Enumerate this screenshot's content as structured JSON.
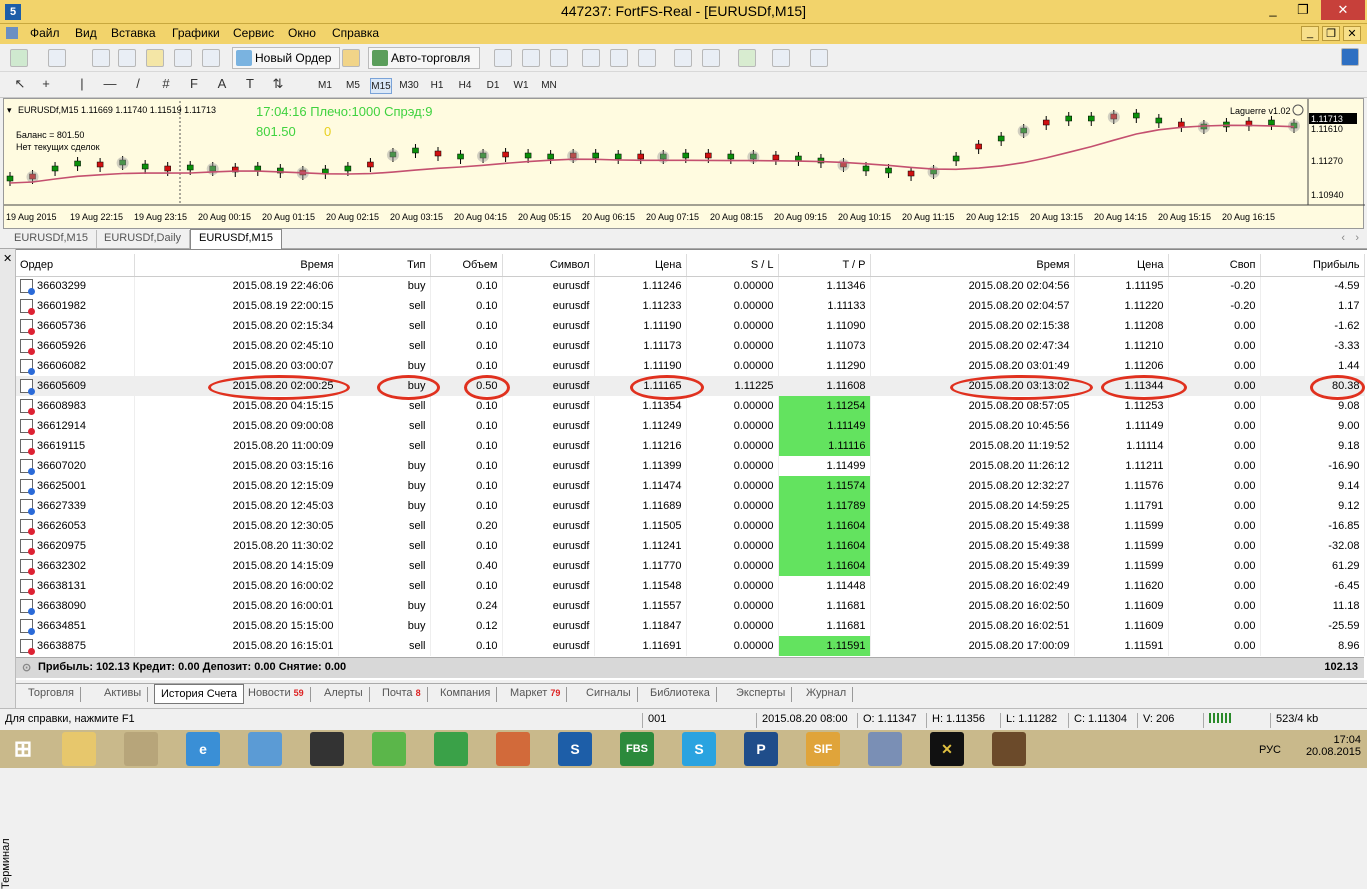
{
  "window": {
    "title": "447237: FortFS-Real - [EURUSDf,M15]",
    "minimize": "_",
    "restore": "❐",
    "close": "✕"
  },
  "menu": [
    "Файл",
    "Вид",
    "Вставка",
    "Графики",
    "Сервис",
    "Окно",
    "Справка"
  ],
  "toolbar": {
    "new_order": "Новый Ордер",
    "auto_trading": "Авто-торговля"
  },
  "timeframes": [
    "M1",
    "M5",
    "M15",
    "M30",
    "H1",
    "H4",
    "D1",
    "W1",
    "MN"
  ],
  "active_timeframe": "M15",
  "chart": {
    "header": "EURUSDf,M15  1.11669 1.11740 1.11519 1.11713",
    "clock_line": "17:04:16 Плечо:1000 Спрэд:9",
    "balance_value": "801.50",
    "zero_value": "0",
    "balance_label": "Баланс = 801.50",
    "no_orders": "Нет текущих сделок",
    "indicator": "Laguerre v1.02",
    "price_labels": [
      "1.11713",
      "1.11610",
      "1.11270",
      "1.10940"
    ],
    "time_labels": [
      "19 Aug 2015",
      "19 Aug 22:15",
      "19 Aug 23:15",
      "20 Aug 00:15",
      "20 Aug 01:15",
      "20 Aug 02:15",
      "20 Aug 03:15",
      "20 Aug 04:15",
      "20 Aug 05:15",
      "20 Aug 06:15",
      "20 Aug 07:15",
      "20 Aug 08:15",
      "20 Aug 09:15",
      "20 Aug 10:15",
      "20 Aug 11:15",
      "20 Aug 12:15",
      "20 Aug 13:15",
      "20 Aug 14:15",
      "20 Aug 15:15",
      "20 Aug 16:15"
    ],
    "line_color": "#c4506f",
    "candle_up": "#0a8f0a",
    "candle_down": "#d01010",
    "bg": "#fffbe0"
  },
  "symbol_tabs": [
    "EURUSDf,M15",
    "EURUSDf,Daily",
    "EURUSDf,M15"
  ],
  "columns": [
    "Ордер",
    "Время",
    "Тип",
    "Объем",
    "Символ",
    "Цена",
    "S / L",
    "T / P",
    "Время",
    "Цена",
    "Своп",
    "Прибыль"
  ],
  "orders": [
    {
      "id": "36603299",
      "open": "2015.08.19 22:46:06",
      "type": "buy",
      "vol": "0.10",
      "sym": "eurusdf",
      "price": "1.11246",
      "sl": "0.00000",
      "tp": "1.11346",
      "close": "2015.08.20 02:04:56",
      "cprice": "1.11195",
      "swap": "-0.20",
      "profit": "-4.59",
      "tphit": false
    },
    {
      "id": "36601982",
      "open": "2015.08.19 22:00:15",
      "type": "sell",
      "vol": "0.10",
      "sym": "eurusdf",
      "price": "1.11233",
      "sl": "0.00000",
      "tp": "1.11133",
      "close": "2015.08.20 02:04:57",
      "cprice": "1.11220",
      "swap": "-0.20",
      "profit": "1.17",
      "tphit": false
    },
    {
      "id": "36605736",
      "open": "2015.08.20 02:15:34",
      "type": "sell",
      "vol": "0.10",
      "sym": "eurusdf",
      "price": "1.11190",
      "sl": "0.00000",
      "tp": "1.11090",
      "close": "2015.08.20 02:15:38",
      "cprice": "1.11208",
      "swap": "0.00",
      "profit": "-1.62",
      "tphit": false
    },
    {
      "id": "36605926",
      "open": "2015.08.20 02:45:10",
      "type": "sell",
      "vol": "0.10",
      "sym": "eurusdf",
      "price": "1.11173",
      "sl": "0.00000",
      "tp": "1.11073",
      "close": "2015.08.20 02:47:34",
      "cprice": "1.11210",
      "swap": "0.00",
      "profit": "-3.33",
      "tphit": false
    },
    {
      "id": "36606082",
      "open": "2015.08.20 03:00:07",
      "type": "buy",
      "vol": "0.10",
      "sym": "eurusdf",
      "price": "1.11190",
      "sl": "0.00000",
      "tp": "1.11290",
      "close": "2015.08.20 03:01:49",
      "cprice": "1.11206",
      "swap": "0.00",
      "profit": "1.44",
      "tphit": false
    },
    {
      "id": "36605609",
      "open": "2015.08.20 02:00:25",
      "type": "buy",
      "vol": "0.50",
      "sym": "eurusdf",
      "price": "1.11165",
      "sl": "1.11225",
      "tp": "1.11608",
      "close": "2015.08.20 03:13:02",
      "cprice": "1.11344",
      "swap": "0.00",
      "profit": "80.38",
      "tphit": false
    },
    {
      "id": "36608983",
      "open": "2015.08.20 04:15:15",
      "type": "sell",
      "vol": "0.10",
      "sym": "eurusdf",
      "price": "1.11354",
      "sl": "0.00000",
      "tp": "1.11254",
      "close": "2015.08.20 08:57:05",
      "cprice": "1.11253",
      "swap": "0.00",
      "profit": "9.08",
      "tphit": true
    },
    {
      "id": "36612914",
      "open": "2015.08.20 09:00:08",
      "type": "sell",
      "vol": "0.10",
      "sym": "eurusdf",
      "price": "1.11249",
      "sl": "0.00000",
      "tp": "1.11149",
      "close": "2015.08.20 10:45:56",
      "cprice": "1.11149",
      "swap": "0.00",
      "profit": "9.00",
      "tphit": true
    },
    {
      "id": "36619115",
      "open": "2015.08.20 11:00:09",
      "type": "sell",
      "vol": "0.10",
      "sym": "eurusdf",
      "price": "1.11216",
      "sl": "0.00000",
      "tp": "1.11116",
      "close": "2015.08.20 11:19:52",
      "cprice": "1.11114",
      "swap": "0.00",
      "profit": "9.18",
      "tphit": true
    },
    {
      "id": "36607020",
      "open": "2015.08.20 03:15:16",
      "type": "buy",
      "vol": "0.10",
      "sym": "eurusdf",
      "price": "1.11399",
      "sl": "0.00000",
      "tp": "1.11499",
      "close": "2015.08.20 11:26:12",
      "cprice": "1.11211",
      "swap": "0.00",
      "profit": "-16.90",
      "tphit": false
    },
    {
      "id": "36625001",
      "open": "2015.08.20 12:15:09",
      "type": "buy",
      "vol": "0.10",
      "sym": "eurusdf",
      "price": "1.11474",
      "sl": "0.00000",
      "tp": "1.11574",
      "close": "2015.08.20 12:32:27",
      "cprice": "1.11576",
      "swap": "0.00",
      "profit": "9.14",
      "tphit": true
    },
    {
      "id": "36627339",
      "open": "2015.08.20 12:45:03",
      "type": "buy",
      "vol": "0.10",
      "sym": "eurusdf",
      "price": "1.11689",
      "sl": "0.00000",
      "tp": "1.11789",
      "close": "2015.08.20 14:59:25",
      "cprice": "1.11791",
      "swap": "0.00",
      "profit": "9.12",
      "tphit": true
    },
    {
      "id": "36626053",
      "open": "2015.08.20 12:30:05",
      "type": "sell",
      "vol": "0.20",
      "sym": "eurusdf",
      "price": "1.11505",
      "sl": "0.00000",
      "tp": "1.11604",
      "close": "2015.08.20 15:49:38",
      "cprice": "1.11599",
      "swap": "0.00",
      "profit": "-16.85",
      "tphit": true
    },
    {
      "id": "36620975",
      "open": "2015.08.20 11:30:02",
      "type": "sell",
      "vol": "0.10",
      "sym": "eurusdf",
      "price": "1.11241",
      "sl": "0.00000",
      "tp": "1.11604",
      "close": "2015.08.20 15:49:38",
      "cprice": "1.11599",
      "swap": "0.00",
      "profit": "-32.08",
      "tphit": true
    },
    {
      "id": "36632302",
      "open": "2015.08.20 14:15:09",
      "type": "sell",
      "vol": "0.40",
      "sym": "eurusdf",
      "price": "1.11770",
      "sl": "0.00000",
      "tp": "1.11604",
      "close": "2015.08.20 15:49:39",
      "cprice": "1.11599",
      "swap": "0.00",
      "profit": "61.29",
      "tphit": true
    },
    {
      "id": "36638131",
      "open": "2015.08.20 16:00:02",
      "type": "sell",
      "vol": "0.10",
      "sym": "eurusdf",
      "price": "1.11548",
      "sl": "0.00000",
      "tp": "1.11448",
      "close": "2015.08.20 16:02:49",
      "cprice": "1.11620",
      "swap": "0.00",
      "profit": "-6.45",
      "tphit": false
    },
    {
      "id": "36638090",
      "open": "2015.08.20 16:00:01",
      "type": "buy",
      "vol": "0.24",
      "sym": "eurusdf",
      "price": "1.11557",
      "sl": "0.00000",
      "tp": "1.11681",
      "close": "2015.08.20 16:02:50",
      "cprice": "1.11609",
      "swap": "0.00",
      "profit": "11.18",
      "tphit": false
    },
    {
      "id": "36634851",
      "open": "2015.08.20 15:15:00",
      "type": "buy",
      "vol": "0.12",
      "sym": "eurusdf",
      "price": "1.11847",
      "sl": "0.00000",
      "tp": "1.11681",
      "close": "2015.08.20 16:02:51",
      "cprice": "1.11609",
      "swap": "0.00",
      "profit": "-25.59",
      "tphit": false
    },
    {
      "id": "36638875",
      "open": "2015.08.20 16:15:01",
      "type": "sell",
      "vol": "0.10",
      "sym": "eurusdf",
      "price": "1.11691",
      "sl": "0.00000",
      "tp": "1.11591",
      "close": "2015.08.20 17:00:09",
      "cprice": "1.11591",
      "swap": "0.00",
      "profit": "8.96",
      "tphit": true
    }
  ],
  "summary": {
    "text": "Прибыль: 102.13  Кредит: 0.00  Депозит: 0.00  Снятие: 0.00",
    "total": "102.13"
  },
  "terminal_label": "Терминал",
  "bottom_tabs": [
    {
      "label": "Торговля",
      "count": ""
    },
    {
      "label": "Активы",
      "count": ""
    },
    {
      "label": "История Счета",
      "count": ""
    },
    {
      "label": "Новости",
      "count": "59"
    },
    {
      "label": "Алерты",
      "count": ""
    },
    {
      "label": "Почта",
      "count": "8"
    },
    {
      "label": "Компания",
      "count": ""
    },
    {
      "label": "Маркет",
      "count": "79"
    },
    {
      "label": "Сигналы",
      "count": ""
    },
    {
      "label": "Библиотека",
      "count": ""
    },
    {
      "label": "Эксперты",
      "count": ""
    },
    {
      "label": "Журнал",
      "count": ""
    }
  ],
  "status": {
    "help": "Для справки, нажмите F1",
    "profile": "001",
    "time": "2015.08.20 08:00",
    "open": "O: 1.11347",
    "high": "H: 1.11356",
    "low": "L: 1.11282",
    "close": "C: 1.11304",
    "volume": "V: 206",
    "traffic": "523/4 kb"
  },
  "taskbar": {
    "apps": [
      "FBS",
      "S",
      "P",
      "SIF"
    ],
    "lang": "РУС",
    "clock": "17:04",
    "date": "20.08.2015"
  }
}
